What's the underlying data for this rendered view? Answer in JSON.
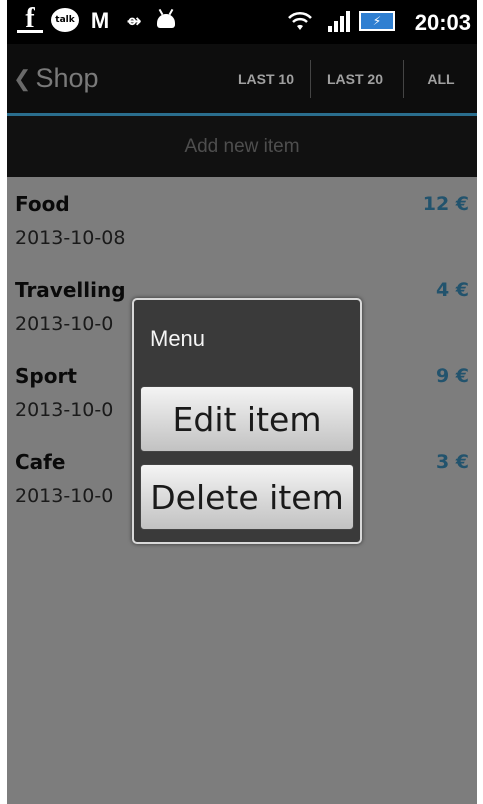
{
  "statusbar": {
    "time": "20:03",
    "icons": [
      "facebook-icon",
      "talk-icon",
      "gmail-icon",
      "usb-icon",
      "android-debug-icon",
      "wifi-icon",
      "signal-icon",
      "battery-charging-icon"
    ],
    "talk_label": "talk"
  },
  "actionbar": {
    "title": "Shop",
    "filters": [
      "LAST 10",
      "LAST 20",
      "ALL"
    ]
  },
  "add_item": {
    "label": "Add new item"
  },
  "items": [
    {
      "title": "Food",
      "date": "2013-10-08",
      "amount": "12 €"
    },
    {
      "title": "Travelling",
      "date": "2013-10-0",
      "amount": "4 €"
    },
    {
      "title": "Sport",
      "date": "2013-10-0",
      "amount": "9 €"
    },
    {
      "title": "Cafe",
      "date": "2013-10-0",
      "amount": "3 €"
    }
  ],
  "dialog": {
    "title": "Menu",
    "options": [
      "Edit item",
      "Delete item"
    ]
  },
  "colors": {
    "accent": "#22536d",
    "actionbar_underline": "#2a6e8e",
    "background": "#7d7d7d"
  }
}
